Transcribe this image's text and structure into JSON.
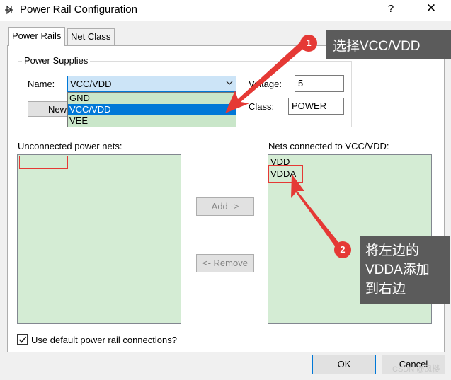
{
  "window": {
    "title": "Power Rail Configuration",
    "help_glyph": "?",
    "close_glyph": "✕"
  },
  "tabs": [
    {
      "label": "Power Rails",
      "active": true
    },
    {
      "label": "Net Class",
      "active": false
    }
  ],
  "power_supplies": {
    "group_title": "Power Supplies",
    "name_label": "Name:",
    "name_value": "VCC/VDD",
    "dropdown_options": [
      "GND",
      "VCC/VDD",
      "VEE"
    ],
    "new_button_label": "New",
    "voltage_label": "Voltage:",
    "voltage_value": "5",
    "class_label": "Class:",
    "class_value": "POWER"
  },
  "unconnected": {
    "label": "Unconnected power nets:",
    "items": []
  },
  "connected": {
    "label": "Nets connected to VCC/VDD:",
    "items": [
      "VDD",
      "VDDA"
    ]
  },
  "buttons": {
    "add_label": "Add ->",
    "remove_label": "<- Remove",
    "ok_label": "OK",
    "cancel_label": "Cancel"
  },
  "checkbox": {
    "label": "Use default power rail connections?",
    "checked": true
  },
  "annotations": [
    {
      "number": "1",
      "text": "选择VCC/VDD"
    },
    {
      "number": "2",
      "text": "将左边的VDDA添加到右边",
      "lines": [
        "将左边的",
        "VDDA添加",
        "到右边"
      ]
    }
  ],
  "watermark": "CSDN @凤楼",
  "colors": {
    "list_background": "#d4ecd4",
    "selection_blue": "#0078d7",
    "annotation_red": "#e53935",
    "callout_gray": "#5b5b5b"
  }
}
